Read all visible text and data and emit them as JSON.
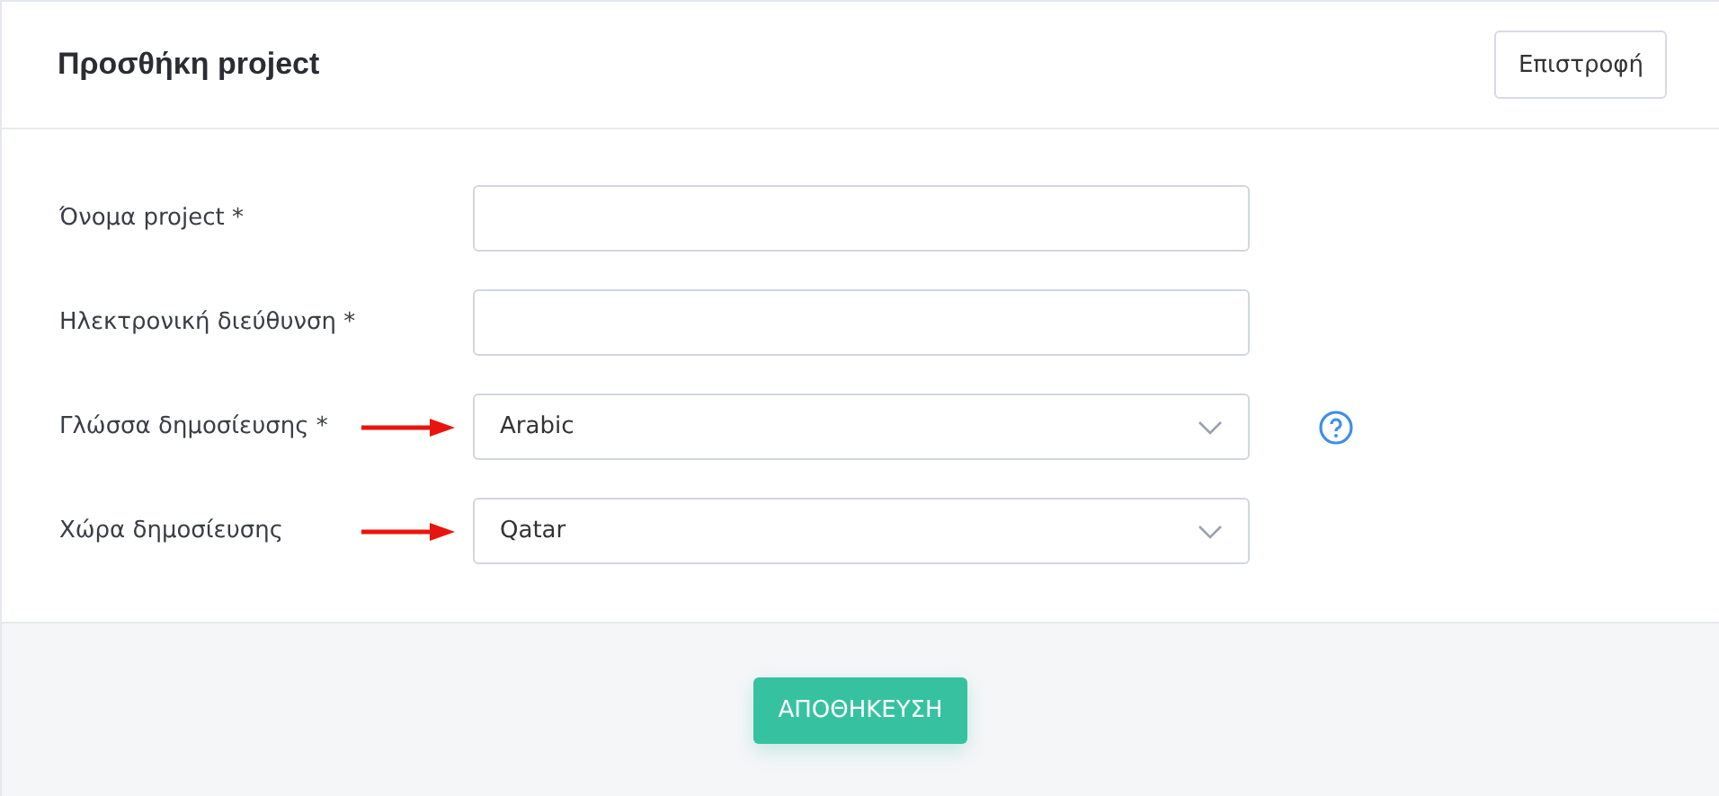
{
  "header": {
    "title": "Προσθήκη project",
    "back_button": "Επιστροφή"
  },
  "fields": [
    {
      "label": "Όνομα project *",
      "kind": "text",
      "arrow": false,
      "help": false
    },
    {
      "label": "Ηλεκτρονική διεύθυνση *",
      "kind": "text",
      "arrow": false,
      "help": false
    },
    {
      "label": "Γλώσσα δημοσίευσης *",
      "kind": "select",
      "value": "Arabic",
      "arrow": true,
      "help": true
    },
    {
      "label": "Χώρα δημοσίευσης",
      "kind": "select",
      "value": "Qatar",
      "arrow": true,
      "help": false
    }
  ],
  "save_button": "ΑΠΟΘΗΚΕΥΣΗ"
}
